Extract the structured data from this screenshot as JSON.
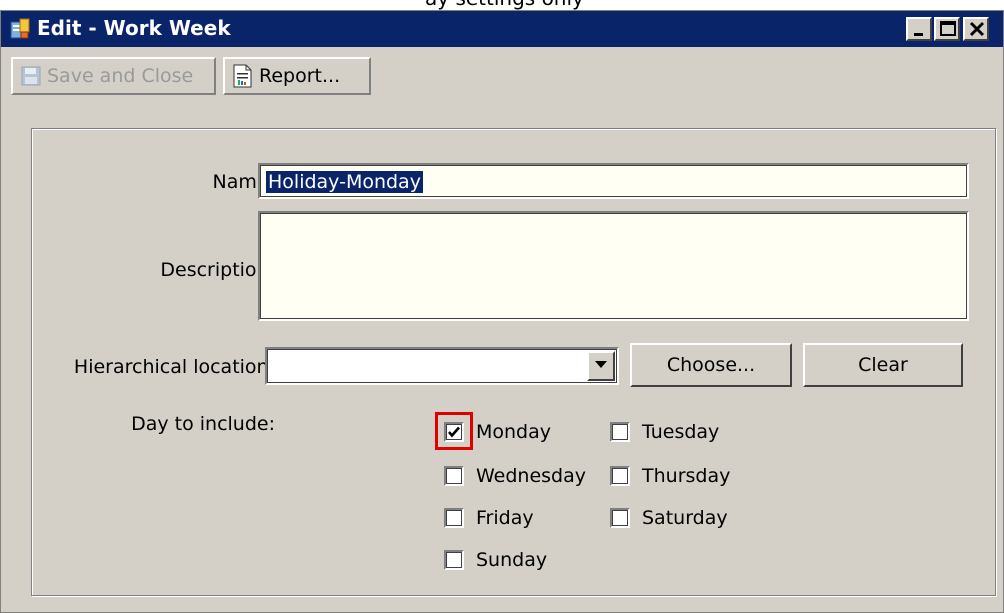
{
  "window": {
    "title": "Edit - Work Week",
    "app_icon": "work-week-app-icon",
    "controls": {
      "minimize_icon": "minimize-icon",
      "maximize_icon": "maximize-icon",
      "close_icon": "close-icon"
    }
  },
  "toolbar": {
    "save_close_label": "Save and Close",
    "save_close_icon": "floppy-disk-icon",
    "save_close_enabled": false,
    "report_label": "Report...",
    "report_icon": "report-icon"
  },
  "form": {
    "name_label": "Name:",
    "name_value": "Holiday-Monday",
    "description_label": "Description:",
    "description_value": "",
    "location_label": "Hierarchical location:",
    "location_value": "",
    "choose_label": "Choose...",
    "clear_label": "Clear",
    "days_label": "Day to include:"
  },
  "days": [
    {
      "label": "Monday",
      "checked": true
    },
    {
      "label": "Tuesday",
      "checked": false
    },
    {
      "label": "Wednesday",
      "checked": false
    },
    {
      "label": "Thursday",
      "checked": false
    },
    {
      "label": "Friday",
      "checked": false
    },
    {
      "label": "Saturday",
      "checked": false
    },
    {
      "label": "Sunday",
      "checked": false
    }
  ],
  "colors": {
    "titlebar": "#0a246a",
    "window_bg": "#d4d0c8",
    "field_bg": "#fffff4",
    "highlight_border": "#e00000"
  },
  "cut_text": "ay settings only"
}
